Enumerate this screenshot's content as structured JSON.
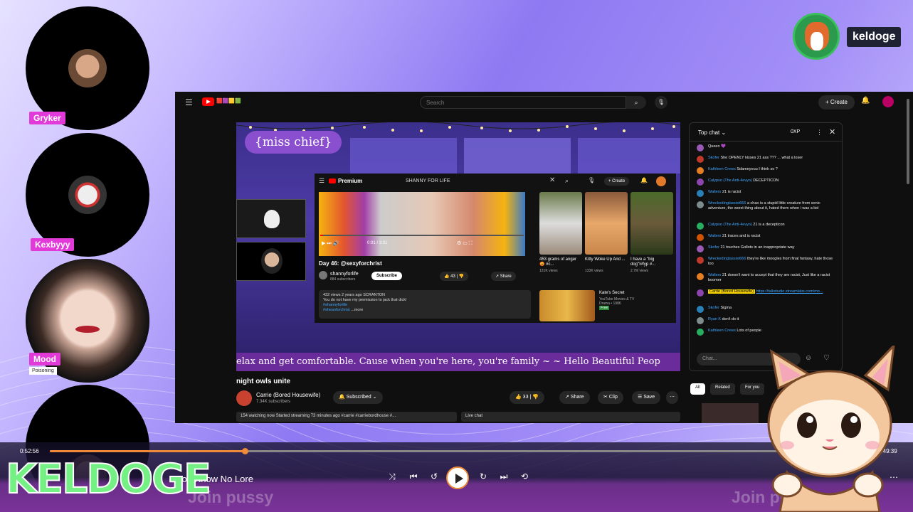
{
  "cams": [
    {
      "name": "Gryker"
    },
    {
      "name": "Kexbyyy"
    },
    {
      "name": "Mood",
      "status": "Poisoning"
    },
    {
      "name": ""
    }
  ],
  "user": {
    "name": "keldoge"
  },
  "browser": {
    "search_placeholder": "Search",
    "create_label": "+ Create"
  },
  "stream": {
    "overlay_title": "{miss chief}",
    "ticker": "elax and get comfortable. Cause when you're here, you're family ~      ~ Hello Beautiful Peop",
    "title": "night owls unite",
    "channel": "Carrie (Bored Housewife)",
    "subscribers": "7.34K subscribers",
    "subscribed_label": "Subscribed",
    "likes": "33",
    "share_label": "Share",
    "clip_label": "Clip",
    "save_label": "Save",
    "meta": "154 watching now  Started streaming 73 minutes ago  #carrie #carriebordhouse #..."
  },
  "nested": {
    "premium_label": "Premium",
    "page_title": "SHANNY FOR LIFE",
    "create_label": "+ Create",
    "video_time": "0:01 / 3:31",
    "video_title": "Day 46: @sexyforchrist",
    "channel": "shannyforlife",
    "subscribers": "884 subscribers",
    "subscribe_label": "Subscribe",
    "likes": "43",
    "share_label": "Share",
    "desc_line1": "432 views  2 years ago  SCRANTON",
    "desc_line2": "You do not have my permission to jack that dick!",
    "desc_tag1": "#shannyforlife",
    "desc_tag2": "#sheanforchrist",
    "desc_more": "...more",
    "thumbs": [
      {
        "title": "453 grams of anger 😡 #c...",
        "meta": "121K views"
      },
      {
        "title": "Kitty Woke Up And ...",
        "meta": "133K views"
      },
      {
        "title": "I have a \"big dog\"!#fyp #...",
        "meta": "2.7M views"
      }
    ],
    "kate_title": "Kate's Secret",
    "kate_meta": "YouTube Movies & TV\nDrama • 1986",
    "kate_tag": "Free"
  },
  "chat": {
    "title": "Top chat",
    "xp": "0XP",
    "input_placeholder": "Chat...",
    "messages": [
      {
        "user": "",
        "text": "Queen 💜"
      },
      {
        "user": "Skofer",
        "text": "She OPENLY kisses 21 ass ??? ... what a loser"
      },
      {
        "user": "Kathleen Crews",
        "text": "Sdameyouu I think so ?"
      },
      {
        "user": "Calypso (The Anti-4evyo)",
        "text": "DECEPTICON"
      },
      {
        "user": "Walters",
        "text": "21 is racist"
      },
      {
        "user": "Wreckedinglassist666",
        "text": "a chao is a stupid little creature from sonic adventure, the worst thing about it, hated them when i was a kid"
      },
      {
        "user": "Calypso (The Anti-4evyo)",
        "text": "21 is a decepticon"
      },
      {
        "user": "Walters",
        "text": "21 traces and is racist"
      },
      {
        "user": "Skofer",
        "text": "21 touches Gollots in an inappropriate way"
      },
      {
        "user": "Wreckedinglassist666",
        "text": "they're like moogles from final fantasy, hate those too"
      },
      {
        "user": "Walters",
        "text": "21 doesn't want to accept that they are racist, Just like a racist boomer"
      },
      {
        "user": "Carrie (Bored Housewife)",
        "text": "https://talkstudio.streamlabs.com/mo...",
        "highlight": true
      },
      {
        "user": "Skofer",
        "text": "Sigma"
      },
      {
        "user": "Ryan K",
        "text": "don't do it"
      },
      {
        "user": "Kathleen Crews",
        "text": "Lots of people"
      }
    ]
  },
  "recs": {
    "all_label": "All",
    "related_label": "Related",
    "foryou_label": "For you"
  },
  "player": {
    "elapsed": "0:52:56",
    "total": "2:49:39",
    "progress": 0.236,
    "now_playing": "You Know No Lore",
    "ticker_left": "Join pussy",
    "ticker_right": "Join pu"
  },
  "brand": "KELDOGE",
  "colors": {
    "name_tag": "#e23ad8",
    "brand_green": "#74f084",
    "accent_orange": "#f08a3b",
    "yt_red": "#ff0000"
  }
}
